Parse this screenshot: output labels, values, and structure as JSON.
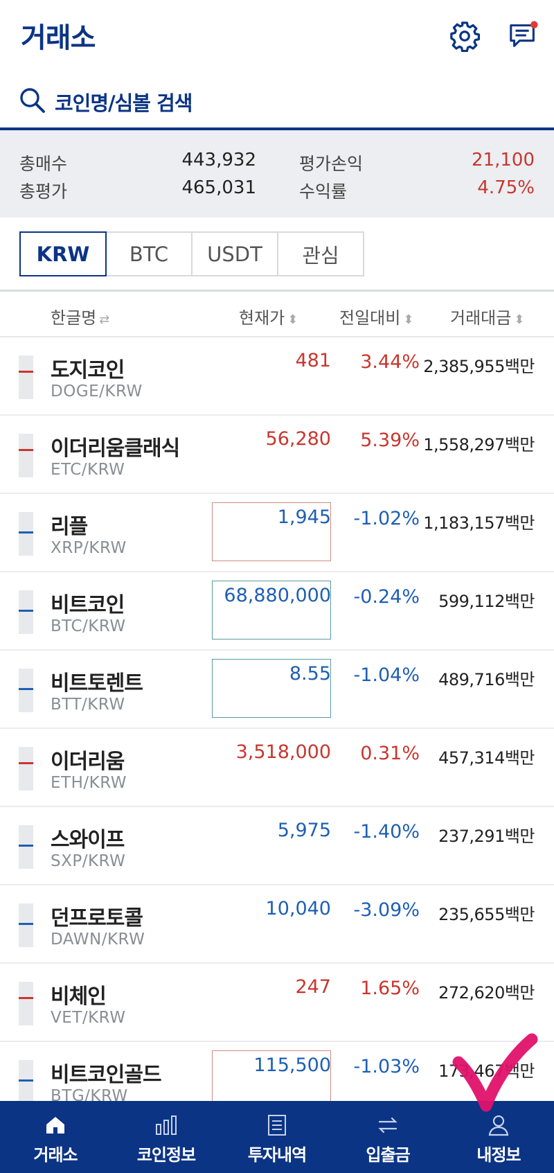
{
  "header": {
    "title": "거래소",
    "notification_color": "#e53935"
  },
  "search": {
    "placeholder": "코인명/심볼 검색"
  },
  "summary": {
    "total_buy_label": "총매수",
    "total_buy_value": "443,932",
    "total_eval_label": "총평가",
    "total_eval_value": "465,031",
    "pnl_label": "평가손익",
    "pnl_value": "21,100",
    "return_label": "수익률",
    "return_value": "4.75%"
  },
  "market_tabs": [
    {
      "label": "KRW",
      "active": true
    },
    {
      "label": "BTC",
      "active": false
    },
    {
      "label": "USDT",
      "active": false
    },
    {
      "label": "관심",
      "active": false
    }
  ],
  "columns": {
    "name": "한글명",
    "price": "현재가",
    "change": "전일대비",
    "volume": "거래대금"
  },
  "coins": [
    {
      "name": "도지코인",
      "code": "DOGE/KRW",
      "price": "481",
      "change": "3.44%",
      "volume": "2,385,955백만",
      "direction": "up",
      "highlight": false
    },
    {
      "name": "이더리움클래식",
      "code": "ETC/KRW",
      "price": "56,280",
      "change": "5.39%",
      "volume": "1,558,297백만",
      "direction": "up",
      "highlight": false
    },
    {
      "name": "리플",
      "code": "XRP/KRW",
      "price": "1,945",
      "change": "-1.02%",
      "volume": "1,183,157백만",
      "direction": "down",
      "highlight": "up"
    },
    {
      "name": "비트코인",
      "code": "BTC/KRW",
      "price": "68,880,000",
      "change": "-0.24%",
      "volume": "599,112백만",
      "direction": "down",
      "highlight": "down"
    },
    {
      "name": "비트토렌트",
      "code": "BTT/KRW",
      "price": "8.55",
      "change": "-1.04%",
      "volume": "489,716백만",
      "direction": "down",
      "highlight": "down"
    },
    {
      "name": "이더리움",
      "code": "ETH/KRW",
      "price": "3,518,000",
      "change": "0.31%",
      "volume": "457,314백만",
      "direction": "up",
      "highlight": false
    },
    {
      "name": "스와이프",
      "code": "SXP/KRW",
      "price": "5,975",
      "change": "-1.40%",
      "volume": "237,291백만",
      "direction": "down",
      "highlight": false
    },
    {
      "name": "던프로토콜",
      "code": "DAWN/KRW",
      "price": "10,040",
      "change": "-3.09%",
      "volume": "235,655백만",
      "direction": "down",
      "highlight": false
    },
    {
      "name": "비체인",
      "code": "VET/KRW",
      "price": "247",
      "change": "1.65%",
      "volume": "272,620백만",
      "direction": "up",
      "highlight": false
    },
    {
      "name": "비트코인골드",
      "code": "BTG/KRW",
      "price": "115,500",
      "change": "-1.03%",
      "volume": "173,467백만",
      "direction": "down",
      "highlight": "up"
    }
  ],
  "bottom_nav": [
    {
      "label": "거래소",
      "icon": "home-icon"
    },
    {
      "label": "코인정보",
      "icon": "bar-chart-icon"
    },
    {
      "label": "투자내역",
      "icon": "document-icon"
    },
    {
      "label": "입출금",
      "icon": "transfer-icon"
    },
    {
      "label": "내정보",
      "icon": "user-icon"
    }
  ],
  "colors": {
    "brand": "#0b3485",
    "up": "#c8362e",
    "down": "#1e5fb4",
    "annotation": "#e0126a"
  }
}
